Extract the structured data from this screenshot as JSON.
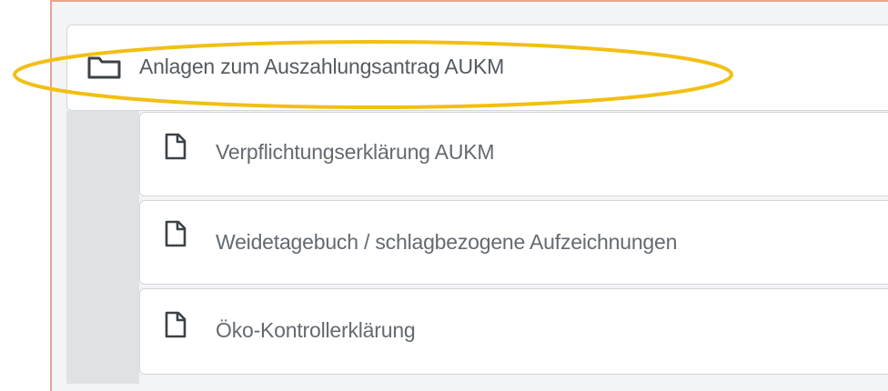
{
  "folder": {
    "label": "Anlagen zum Auszahlungsantrag AUKM",
    "icon": "folder-icon"
  },
  "documents": [
    {
      "label": "Verpflichtungserklärung AUKM",
      "icon": "document-icon"
    },
    {
      "label": "Weidetagebuch / schlagbezogene Aufzeichnungen",
      "icon": "document-icon"
    },
    {
      "label": "Öko-Kontrollerklärung",
      "icon": "document-icon"
    }
  ],
  "colors": {
    "frame_border": "#e8a48c",
    "highlight": "#f2bf12",
    "text": "#555b61",
    "nested_background": "#dfe2e5"
  }
}
